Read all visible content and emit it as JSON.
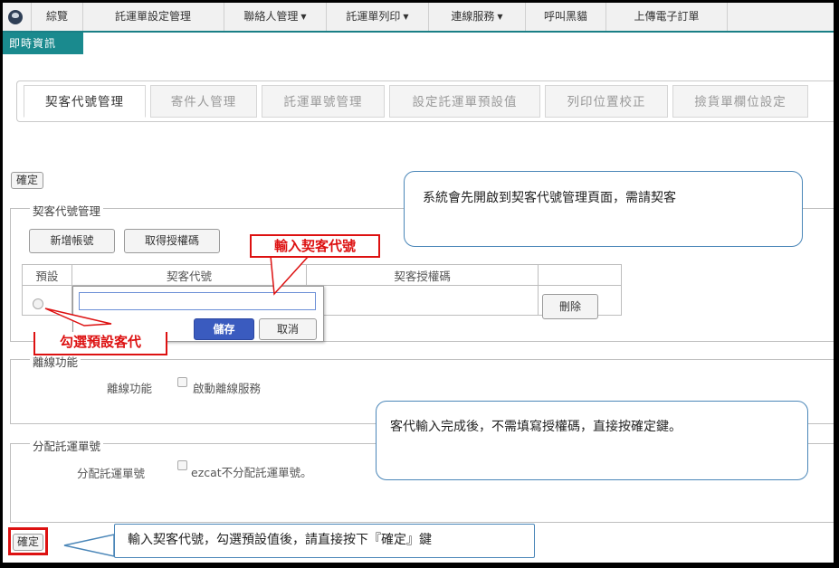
{
  "nav": {
    "items": [
      "綜覽",
      "託運單設定管理",
      "聯絡人管理",
      "託運單列印",
      "連線服務",
      "呼叫黑貓",
      "上傳電子訂單"
    ],
    "info_tab": "即時資訊"
  },
  "tabs": [
    "契客代號管理",
    "寄件人管理",
    "託運單號管理",
    "設定託運單預設值",
    "列印位置校正",
    "撿貨單欄位設定"
  ],
  "buttons": {
    "confirm_top": "確定",
    "confirm_bottom": "確定",
    "add_account": "新增帳號",
    "get_auth": "取得授權碼",
    "save": "儲存",
    "cancel": "取消",
    "delete": "刪除"
  },
  "sections": {
    "customer_code": "契客代號管理",
    "offline": "離線功能",
    "assign": "分配託運單號"
  },
  "table": {
    "headers": [
      "預設",
      "契客代號",
      "契客授權碼"
    ]
  },
  "popup": {
    "input_value": ""
  },
  "offline": {
    "label": "離線功能",
    "checkbox_label": "啟動離線服務"
  },
  "assign": {
    "label": "分配託運單號",
    "checkbox_label": "ezcat不分配託運單號。"
  },
  "annotations": {
    "bubble_top": "系統會先開啟到契客代號管理頁面，需請契客",
    "bubble_mid": "客代輸入完成後，不需填寫授權碼，直接按確定鍵。",
    "bubble_bottom": "輸入契客代號，勾選預設值後，請直接按下『確定』鍵",
    "red_input": "輸入契客代號",
    "red_default": "勾選預設客代"
  },
  "colors": {
    "teal": "#1a8a8e",
    "red": "#dd1111",
    "bubble_border": "#4a86b8",
    "save_button": "#3a5bbf"
  }
}
